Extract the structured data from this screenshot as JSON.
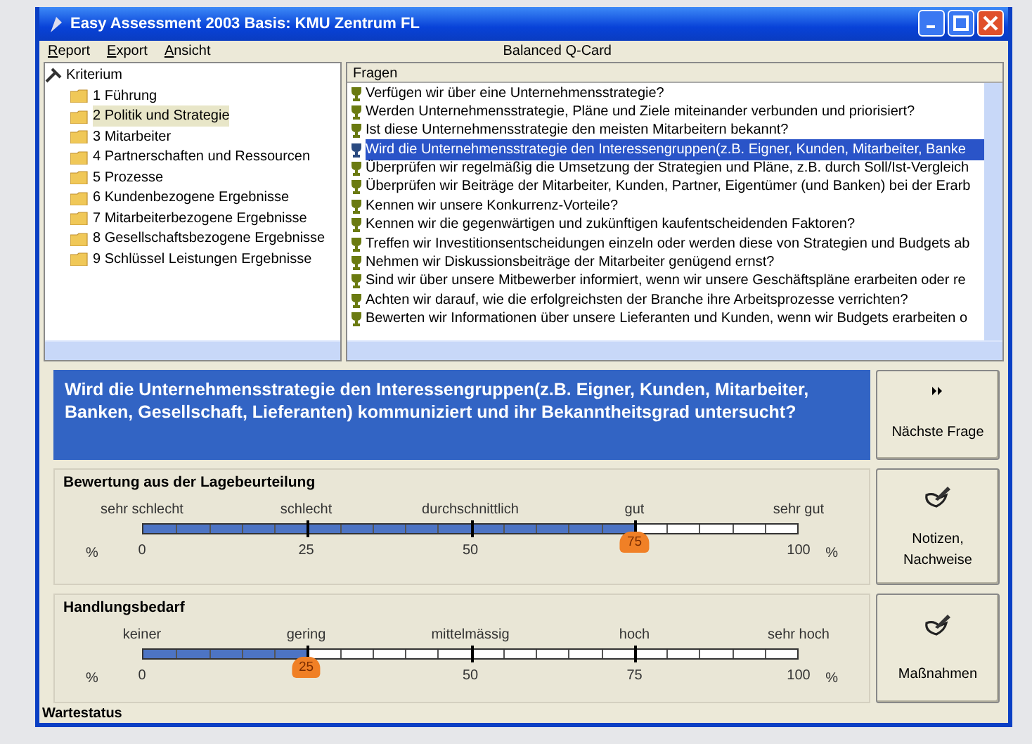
{
  "window": {
    "title": "Easy Assessment 2003 Basis: KMU Zentrum FL"
  },
  "menu": [
    {
      "label": "Report"
    },
    {
      "label": "Export"
    },
    {
      "label": "Ansicht"
    }
  ],
  "header_title": "Balanced Q-Card",
  "tree": {
    "root": "Kriterium",
    "children": [
      {
        "label": "1 Führung",
        "selected": false
      },
      {
        "label": "2 Politik und Strategie",
        "selected": true
      },
      {
        "label": "3 Mitarbeiter",
        "selected": false
      },
      {
        "label": "4 Partnerschaften und Ressourcen",
        "selected": false
      },
      {
        "label": "5 Prozesse",
        "selected": false
      },
      {
        "label": "6 Kundenbezogene Ergebnisse",
        "selected": false
      },
      {
        "label": "7 Mitarbeiterbezogene Ergebnisse",
        "selected": false
      },
      {
        "label": "8 Gesellschaftsbezogene Ergebnisse",
        "selected": false
      },
      {
        "label": "9 Schlüssel Leistungen Ergebnisse",
        "selected": false
      }
    ]
  },
  "questions": {
    "header": "Fragen",
    "items": [
      {
        "text": "Verfügen wir über eine Unternehmensstrategie?",
        "selected": false
      },
      {
        "text": "Werden Unternehmensstrategie, Pläne und Ziele miteinander verbunden und priorisiert?",
        "selected": false
      },
      {
        "text": "Ist diese Unternehmensstrategie den meisten Mitarbeitern bekannt?",
        "selected": false
      },
      {
        "text": "Wird die Unternehmensstrategie den Interessengruppen(z.B. Eigner, Kunden, Mitarbeiter, Banke",
        "selected": true
      },
      {
        "text": "Überprüfen wir regelmäßig die Umsetzung der Strategien und Pläne, z.B. durch Soll/Ist-Vergleich",
        "selected": false
      },
      {
        "text": "Überprüfen wir Beiträge der Mitarbeiter, Kunden, Partner, Eigentümer (und Banken) bei der Erarb",
        "selected": false
      },
      {
        "text": "Kennen wir unsere Konkurrenz-Vorteile?",
        "selected": false
      },
      {
        "text": "Kennen wir die gegenwärtigen und zukünftigen kaufentscheidenden Faktoren?",
        "selected": false
      },
      {
        "text": "Treffen wir Investitionsentscheidungen einzeln oder werden diese von Strategien und Budgets ab",
        "selected": false
      },
      {
        "text": "Nehmen wir Diskussionsbeiträge der Mitarbeiter genügend ernst?",
        "selected": false
      },
      {
        "text": "Sind wir über unsere Mitbewerber informiert, wenn wir unsere Geschäftspläne erarbeiten oder re",
        "selected": false
      },
      {
        "text": "Achten wir darauf, wie die erfolgreichsten der Branche ihre Arbeitsprozesse verrichten?",
        "selected": false
      },
      {
        "text": "Bewerten wir Informationen über unsere Lieferanten und Kunden, wenn wir Budgets erarbeiten o",
        "selected": false
      }
    ]
  },
  "current_question": "Wird die Unternehmensstrategie den Interessengruppen(z.B. Eigner, Kunden, Mitarbeiter, Banken, Gesellschaft, Lieferanten) kommuniziert und ihr Bekanntheitsgrad untersucht?",
  "next_button": {
    "label": "Nächste Frage"
  },
  "ratings": [
    {
      "title": "Bewertung aus der Lagebeurteilung",
      "scale_labels": [
        "sehr schlecht",
        "schlecht",
        "durchschnittlich",
        "gut",
        "sehr gut"
      ],
      "ticks": [
        "0",
        "25",
        "50",
        "75",
        "100"
      ],
      "unit_left": "%",
      "unit_right": "%",
      "level": 0.75,
      "button": "Notizen, Nachweise"
    },
    {
      "title": "Handlungsbedarf",
      "scale_labels": [
        "keiner",
        "gering",
        "mittelmässig",
        "hoch",
        "sehr hoch"
      ],
      "ticks": [
        "0",
        "25",
        "50",
        "75",
        "100"
      ],
      "unit_left": "%",
      "unit_right": "%",
      "level": 0.25,
      "button": "Maßnahmen"
    }
  ],
  "status_bar": "Wartestatus"
}
